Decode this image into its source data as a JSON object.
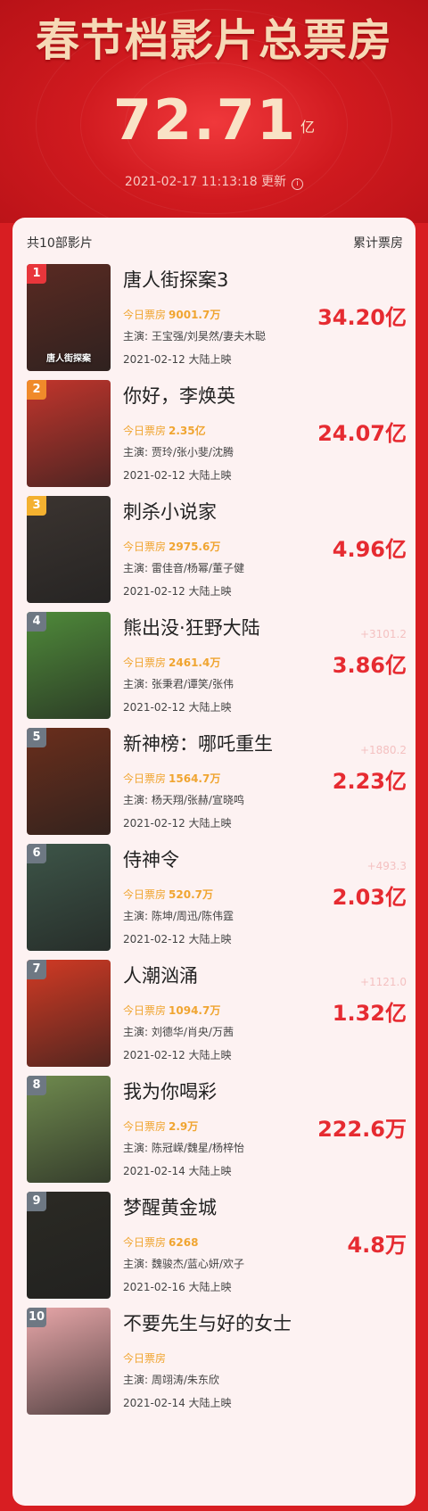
{
  "header": {
    "title": "春节档影片总票房",
    "total_value": "72.71",
    "total_unit": "亿",
    "updated": "2021-02-17 11:13:18 更新",
    "info_icon": "info-icon"
  },
  "list": {
    "count_label": "共10部影片",
    "column_label": "累计票房",
    "today_label": "今日票房",
    "colors": {
      "accent": "#e62b31",
      "today": "#f0a531",
      "rank1": "#e8363b",
      "rank2": "#f08a2a",
      "rank3": "#f4b130",
      "rank_other": "#6e7883"
    },
    "films": [
      {
        "rank": "1",
        "title": "唐人街探案3",
        "today": "9001.7万",
        "cast": "主演: 王宝强/刘昊然/妻夫木聪",
        "release": "2021-02-12 大陆上映",
        "total": "34.20亿",
        "delta": "",
        "poster_text": "唐人街探案",
        "poster_bg": "#5a2a22"
      },
      {
        "rank": "2",
        "title": "你好，李焕英",
        "today": "2.35亿",
        "cast": "主演: 贾玲/张小斐/沈腾",
        "release": "2021-02-12 大陆上映",
        "total": "24.07亿",
        "delta": "",
        "poster_text": "",
        "poster_bg": "#c2352c"
      },
      {
        "rank": "3",
        "title": "刺杀小说家",
        "today": "2975.6万",
        "cast": "主演: 雷佳音/杨幂/董子健",
        "release": "2021-02-12 大陆上映",
        "total": "4.96亿",
        "delta": "",
        "poster_text": "",
        "poster_bg": "#3b3430"
      },
      {
        "rank": "4",
        "title": "熊出没·狂野大陆",
        "today": "2461.4万",
        "cast": "主演: 张秉君/谭笑/张伟",
        "release": "2021-02-12 大陆上映",
        "total": "3.86亿",
        "delta": "+3101.2",
        "poster_text": "",
        "poster_bg": "#4f8a3a"
      },
      {
        "rank": "5",
        "title": "新神榜：哪吒重生",
        "today": "1564.7万",
        "cast": "主演: 杨天翔/张赫/宣晓鸣",
        "release": "2021-02-12 大陆上映",
        "total": "2.23亿",
        "delta": "+1880.2",
        "poster_text": "",
        "poster_bg": "#6a2e1c"
      },
      {
        "rank": "6",
        "title": "侍神令",
        "today": "520.7万",
        "cast": "主演: 陈坤/周迅/陈伟霆",
        "release": "2021-02-12 大陆上映",
        "total": "2.03亿",
        "delta": "+493.3",
        "poster_text": "",
        "poster_bg": "#3d5548"
      },
      {
        "rank": "7",
        "title": "人潮汹涌",
        "today": "1094.7万",
        "cast": "主演: 刘德华/肖央/万茜",
        "release": "2021-02-12 大陆上映",
        "total": "1.32亿",
        "delta": "+1121.0",
        "poster_text": "",
        "poster_bg": "#d23a24"
      },
      {
        "rank": "8",
        "title": "我为你喝彩",
        "today": "2.9万",
        "cast": "主演: 陈冠嵘/魏星/杨梓怡",
        "release": "2021-02-14 大陆上映",
        "total": "222.6万",
        "delta": "",
        "poster_text": "",
        "poster_bg": "#6f8a4e"
      },
      {
        "rank": "9",
        "title": "梦醒黄金城",
        "today": "6268",
        "cast": "主演: 魏骏杰/蓝心妍/欢子",
        "release": "2021-02-16 大陆上映",
        "total": "4.8万",
        "delta": "",
        "poster_text": "",
        "poster_bg": "#2b2a24"
      },
      {
        "rank": "10",
        "title": "不要先生与好的女士",
        "today": "",
        "cast": "主演: 周翊涛/朱东欣",
        "release": "2021-02-14 大陆上映",
        "total": "",
        "delta": "",
        "poster_text": "",
        "poster_bg": "#e7a6a8"
      }
    ]
  }
}
